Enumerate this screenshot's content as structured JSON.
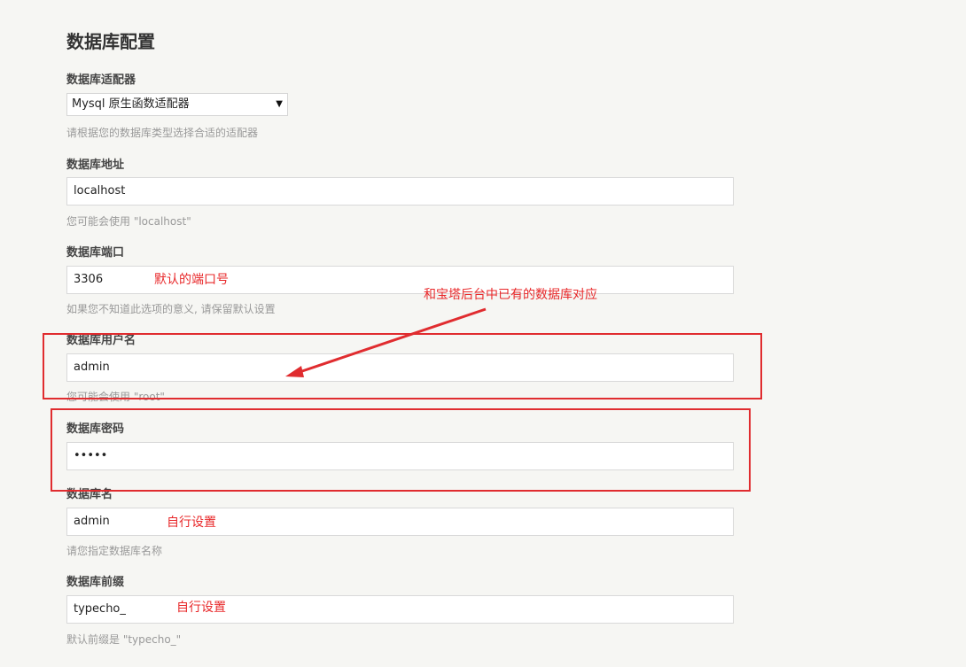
{
  "section": {
    "title": "数据库配置"
  },
  "fields": {
    "adapter": {
      "label": "数据库适配器",
      "value": "Mysql 原生函数适配器",
      "desc": "请根据您的数据库类型选择合适的适配器"
    },
    "host": {
      "label": "数据库地址",
      "value": "localhost",
      "desc": "您可能会使用 \"localhost\""
    },
    "port": {
      "label": "数据库端口",
      "value": "3306",
      "desc": "如果您不知道此选项的意义, 请保留默认设置"
    },
    "user": {
      "label": "数据库用户名",
      "value": "admin",
      "desc": "您可能会使用 \"root\""
    },
    "password": {
      "label": "数据库密码",
      "value": "•••••"
    },
    "dbname": {
      "label": "数据库名",
      "value": "admin",
      "desc": "请您指定数据库名称"
    },
    "prefix": {
      "label": "数据库前缀",
      "value": "typecho_",
      "desc": "默认前缀是 \"typecho_\""
    }
  },
  "annotations": {
    "port_note": "默认的端口号",
    "arrow_note": "和宝塔后台中已有的数据库对应",
    "dbname_note": "自行设置",
    "prefix_note": "自行设置"
  },
  "colors": {
    "annotation": "#e8282a",
    "background": "#f6f6f3"
  }
}
